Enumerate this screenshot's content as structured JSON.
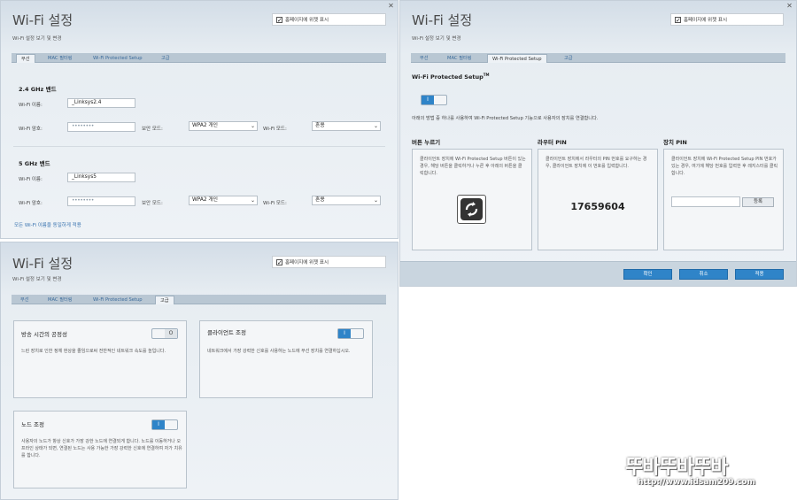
{
  "common": {
    "title": "Wi-Fi 설정",
    "subtitle": "Wi-Fi 설정 보기 및 변경",
    "show_on_homepage": "홈페이지에 위젯 표시",
    "close_glyph": "✕"
  },
  "tabs": [
    "무선",
    "MAC 필터링",
    "Wi-Fi Protected Setup",
    "고급"
  ],
  "wireless": {
    "band24": {
      "header": "2.4 GHz 밴드",
      "name_label": "Wi-Fi 이름:",
      "name_value": "_Linksys2.4",
      "pw_label": "Wi-Fi 암호:",
      "pw_value": "••••••••",
      "security_label": "보안 모드:",
      "security_value": "WPA2 개인",
      "mode_label": "Wi-Fi 모드:",
      "mode_value": "혼용"
    },
    "band5": {
      "header": "5 GHz 밴드",
      "name_label": "Wi-Fi 이름:",
      "name_value": "_Linksys5",
      "pw_label": "Wi-Fi 암호:",
      "pw_value": "••••••••",
      "security_label": "보안 모드:",
      "security_value": "WPA2 개인",
      "mode_label": "Wi-Fi 모드:",
      "mode_value": "혼용"
    },
    "same_name_link": "모든 Wi-Fi 이름을 동일하게 적용"
  },
  "wps": {
    "heading": "Wi-Fi Protected Setup",
    "heading_tm": "TM",
    "toggle": "I",
    "instruction": "아래의 방법 중 하나를 사용하여 Wi-Fi Protected Setup 기능으로 사용자의 장치를 연결합니다.",
    "button_panel": {
      "title": "버튼 누르기",
      "text": "클라이언트 장치에 Wi-Fi Protected Setup 버튼이 있는 경우, 해당 버튼을 클릭하거나 누른 후 아래의 버튼을 클릭합니다."
    },
    "router_pin_panel": {
      "title": "라우터 PIN",
      "text": "클라이언트 장치에서 라우터의 PIN 번호를 요구하는 경우, 클라이언트 장치에 이 번호를 입력합니다.",
      "pin": "17659604"
    },
    "device_pin_panel": {
      "title": "장치 PIN",
      "text": "클라이언트 장치에 Wi-Fi Protected Setup PIN 번호가 있는 경우, 여기에 해당 번호를 입력한 후 레지스터를 클릭합니다.",
      "register": "등록"
    },
    "footer": {
      "ok": "확인",
      "cancel": "취소",
      "apply": "적용"
    }
  },
  "advanced": {
    "airtime": {
      "title": "방송 시간의 공정성",
      "text": "느린 장치로 인한 정체 현상을 줄임으로써 전반적인 네트워크 속도를 높입니다.",
      "toggle": "O"
    },
    "client_steering": {
      "title": "클라이언트 조정",
      "text": "네트워크에서 가장 강력한 신호를 사용하는 노드에 무선 장치를 연결하십시오.",
      "toggle": "I"
    },
    "node_steering": {
      "title": "노드 조정",
      "text": "사용자의 노드가 항상 신호가 가장 강한 노드에 연결되게 합니다. 노드를 이동하거나 오프라인 상태가 되면, 연결된 노드는 사용 가능한 가장 강력한 신호에 연결하여 자가 치유를 합니다.",
      "toggle": "I"
    }
  },
  "watermark": {
    "logo": "뚜바뚜바뚜바",
    "url": "http://www.idsam209.com"
  }
}
